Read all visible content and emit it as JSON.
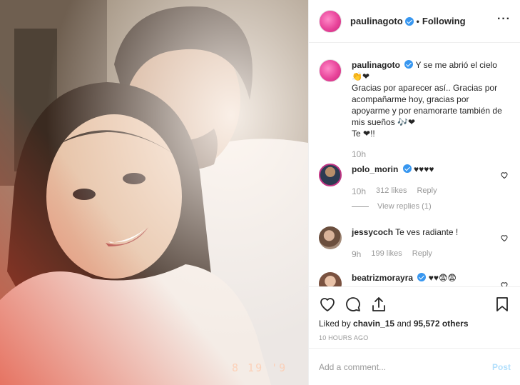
{
  "header": {
    "username": "paulinagoto",
    "separator": "•",
    "follow_status": "Following",
    "more_icon": "more-horizontal-icon"
  },
  "photo": {
    "date_stamp": "8 19 '9"
  },
  "caption": {
    "username": "paulinagoto",
    "text": "Y se me abrió el cielo 👏❤\nGracias por aparecer así.. Gracias por acompañarme hoy, gracias por apoyarme y por enamorarte también de mis sueños 🎶❤\nTe ❤!!",
    "time": "10h"
  },
  "comments": [
    {
      "username": "polo_morin",
      "verified": true,
      "text": "♥♥♥♥",
      "time": "10h",
      "likes": "312 likes",
      "reply": "Reply",
      "view_replies": "View replies (1)"
    },
    {
      "username": "jessycoch",
      "verified": false,
      "text": "Te ves radiante !",
      "time": "9h",
      "likes": "199 likes",
      "reply": "Reply"
    },
    {
      "username": "beatrizmorayra",
      "verified": true,
      "text": "♥♥😨😨"
    }
  ],
  "actions": {
    "like_icon": "heart-icon",
    "comment_icon": "comment-icon",
    "share_icon": "share-icon",
    "save_icon": "bookmark-icon"
  },
  "likes": {
    "prefix": "Liked by",
    "user": "chavin_15",
    "and": "and",
    "count": "95,572 others"
  },
  "posted_ago": "10 HOURS AGO",
  "comment_box": {
    "placeholder": "Add a comment...",
    "post_label": "Post"
  },
  "colors": {
    "verified": "#3897f0",
    "post_disabled": "#b2dffc",
    "muted": "#999999"
  }
}
